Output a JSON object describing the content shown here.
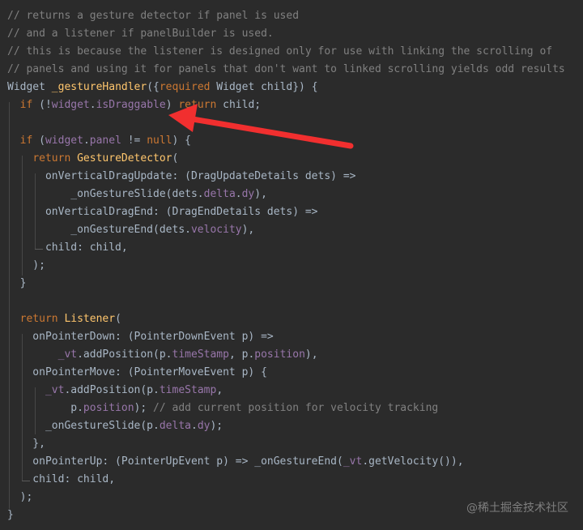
{
  "editor": {
    "lines": [
      [
        {
          "t": "// returns a gesture detector if panel is used",
          "c": "comment"
        }
      ],
      [
        {
          "t": "// and a listener if panelBuilder is used.",
          "c": "comment"
        }
      ],
      [
        {
          "t": "// this is because the listener is designed only for use with linking the scrolling of",
          "c": "comment"
        }
      ],
      [
        {
          "t": "// panels and using it for panels that don't want to linked scrolling yields odd results",
          "c": "comment"
        }
      ],
      [
        {
          "t": "Widget ",
          "c": "plain"
        },
        {
          "t": "_gestureHandler",
          "c": "function"
        },
        {
          "t": "({",
          "c": "plain"
        },
        {
          "t": "required",
          "c": "keyword"
        },
        {
          "t": " Widget child}) {",
          "c": "plain"
        }
      ],
      [
        {
          "t": "  ",
          "c": "plain"
        },
        {
          "t": "if",
          "c": "keyword"
        },
        {
          "t": " (!",
          "c": "plain"
        },
        {
          "t": "widget",
          "c": "field"
        },
        {
          "t": ".",
          "c": "plain"
        },
        {
          "t": "isDraggable",
          "c": "field"
        },
        {
          "t": ") ",
          "c": "plain"
        },
        {
          "t": "return",
          "c": "keyword"
        },
        {
          "t": " child;",
          "c": "plain"
        }
      ],
      [],
      [
        {
          "t": "  ",
          "c": "plain"
        },
        {
          "t": "if",
          "c": "keyword"
        },
        {
          "t": " (",
          "c": "plain"
        },
        {
          "t": "widget",
          "c": "field"
        },
        {
          "t": ".",
          "c": "plain"
        },
        {
          "t": "panel",
          "c": "field"
        },
        {
          "t": " != ",
          "c": "plain"
        },
        {
          "t": "null",
          "c": "keyword"
        },
        {
          "t": ") {",
          "c": "plain"
        }
      ],
      [
        {
          "t": "    ",
          "c": "plain"
        },
        {
          "t": "return",
          "c": "keyword"
        },
        {
          "t": " ",
          "c": "plain"
        },
        {
          "t": "GestureDetector",
          "c": "function"
        },
        {
          "t": "(",
          "c": "plain"
        }
      ],
      [
        {
          "t": "      onVerticalDragUpdate: (DragUpdateDetails dets) =>",
          "c": "plain"
        }
      ],
      [
        {
          "t": "          _onGestureSlide(dets.",
          "c": "plain"
        },
        {
          "t": "delta",
          "c": "field"
        },
        {
          "t": ".",
          "c": "plain"
        },
        {
          "t": "dy",
          "c": "field"
        },
        {
          "t": "),",
          "c": "plain"
        }
      ],
      [
        {
          "t": "      onVerticalDragEnd: (DragEndDetails dets) =>",
          "c": "plain"
        }
      ],
      [
        {
          "t": "          _onGestureEnd(dets.",
          "c": "plain"
        },
        {
          "t": "velocity",
          "c": "field"
        },
        {
          "t": "),",
          "c": "plain"
        }
      ],
      [
        {
          "t": "      child: child,",
          "c": "plain"
        }
      ],
      [
        {
          "t": "    );",
          "c": "plain"
        }
      ],
      [
        {
          "t": "  }",
          "c": "plain"
        }
      ],
      [],
      [
        {
          "t": "  ",
          "c": "plain"
        },
        {
          "t": "return",
          "c": "keyword"
        },
        {
          "t": " ",
          "c": "plain"
        },
        {
          "t": "Listener",
          "c": "function"
        },
        {
          "t": "(",
          "c": "plain"
        }
      ],
      [
        {
          "t": "    onPointerDown: (PointerDownEvent p) =>",
          "c": "plain"
        }
      ],
      [
        {
          "t": "        ",
          "c": "plain"
        },
        {
          "t": "_vt",
          "c": "field"
        },
        {
          "t": ".addPosition(p.",
          "c": "plain"
        },
        {
          "t": "timeStamp",
          "c": "field"
        },
        {
          "t": ", p.",
          "c": "plain"
        },
        {
          "t": "position",
          "c": "field"
        },
        {
          "t": "),",
          "c": "plain"
        }
      ],
      [
        {
          "t": "    onPointerMove: (PointerMoveEvent p) {",
          "c": "plain"
        }
      ],
      [
        {
          "t": "      ",
          "c": "plain"
        },
        {
          "t": "_vt",
          "c": "field"
        },
        {
          "t": ".addPosition(p.",
          "c": "plain"
        },
        {
          "t": "timeStamp",
          "c": "field"
        },
        {
          "t": ",",
          "c": "plain"
        }
      ],
      [
        {
          "t": "          p.",
          "c": "plain"
        },
        {
          "t": "position",
          "c": "field"
        },
        {
          "t": "); ",
          "c": "plain"
        },
        {
          "t": "// add current position for velocity tracking",
          "c": "comment"
        }
      ],
      [
        {
          "t": "      _onGestureSlide(p.",
          "c": "plain"
        },
        {
          "t": "delta",
          "c": "field"
        },
        {
          "t": ".",
          "c": "plain"
        },
        {
          "t": "dy",
          "c": "field"
        },
        {
          "t": ");",
          "c": "plain"
        }
      ],
      [
        {
          "t": "    },",
          "c": "plain"
        }
      ],
      [
        {
          "t": "    onPointerUp: (PointerUpEvent p) => _onGestureEnd(",
          "c": "plain"
        },
        {
          "t": "_vt",
          "c": "field"
        },
        {
          "t": ".getVelocity()),",
          "c": "plain"
        }
      ],
      [
        {
          "t": "    child: child,",
          "c": "plain"
        }
      ],
      [
        {
          "t": "  );",
          "c": "plain"
        }
      ],
      [
        {
          "t": "}",
          "c": "plain"
        }
      ]
    ]
  },
  "annotation": {
    "icon": "red-arrow-icon",
    "color": "#f12f2f"
  },
  "watermark": {
    "text": "@稀土掘金技术社区"
  },
  "colors": {
    "background": "#2b2b2b",
    "comment": "#808080",
    "keyword": "#cc7832",
    "function": "#ffc66d",
    "field": "#9876aa",
    "plain": "#a9b7c6"
  }
}
